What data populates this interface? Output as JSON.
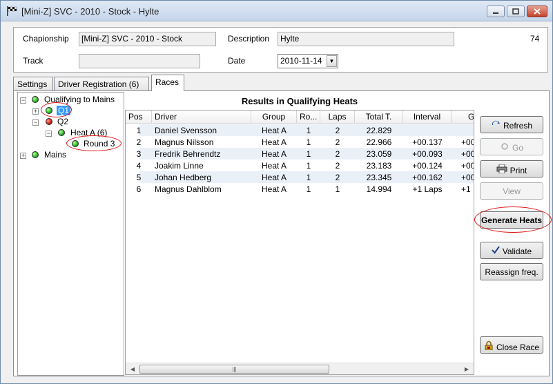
{
  "window": {
    "title": "[Mini-Z] SVC - 2010 - Stock - Hylte"
  },
  "info": {
    "championship_label": "Chapionship",
    "championship_value": "[Mini-Z] SVC - 2010 - Stock",
    "description_label": "Description",
    "description_value": "Hylte",
    "track_label": "Track",
    "track_value": "",
    "date_label": "Date",
    "date_value": "2010-11-14",
    "record_id": "74"
  },
  "tabs": [
    "Settings",
    "Driver Registration (6)",
    "Races"
  ],
  "tree": {
    "root1": "Qualifying to Mains",
    "q1": "Q1",
    "q2": "Q2",
    "heat": "Heat A (6)",
    "round": "Round 3",
    "mains": "Mains"
  },
  "grid": {
    "title": "Results in Qualifying Heats",
    "headers": [
      "Pos",
      "Driver",
      "Group",
      "Ro...",
      "Laps",
      "Total T.",
      "Interval",
      "G"
    ],
    "rows": [
      [
        "1",
        "Daniel Svensson",
        "Heat A",
        "1",
        "2",
        "22.829",
        "",
        ""
      ],
      [
        "2",
        "Magnus Nilsson",
        "Heat A",
        "1",
        "2",
        "22.966",
        "+00.137",
        "+00"
      ],
      [
        "3",
        "Fredrik Behrendtz",
        "Heat A",
        "1",
        "2",
        "23.059",
        "+00.093",
        "+00"
      ],
      [
        "4",
        "Joakim Linne",
        "Heat A",
        "1",
        "2",
        "23.183",
        "+00.124",
        "+00"
      ],
      [
        "5",
        "Johan Hedberg",
        "Heat A",
        "1",
        "2",
        "23.345",
        "+00.162",
        "+00"
      ],
      [
        "6",
        "Magnus Dahlblom",
        "Heat A",
        "1",
        "1",
        "14.994",
        "+1 Laps",
        "+1"
      ]
    ]
  },
  "buttons": {
    "refresh": "Refresh",
    "go": "Go",
    "print": "Print",
    "view": "View",
    "generate": "Generate Heats",
    "validate": "Validate",
    "reassign": "Reassign freq.",
    "close_race": "Close Race"
  },
  "icons": {
    "refresh": "refresh-icon",
    "go": "go-icon",
    "print": "printer-icon",
    "validate": "checkmark-icon",
    "close_race": "lock-icon"
  },
  "colors": {
    "highlight_ring": "#e01010",
    "selection": "#3399ff",
    "status_green": "#25b52a",
    "status_red": "#d01b12"
  }
}
